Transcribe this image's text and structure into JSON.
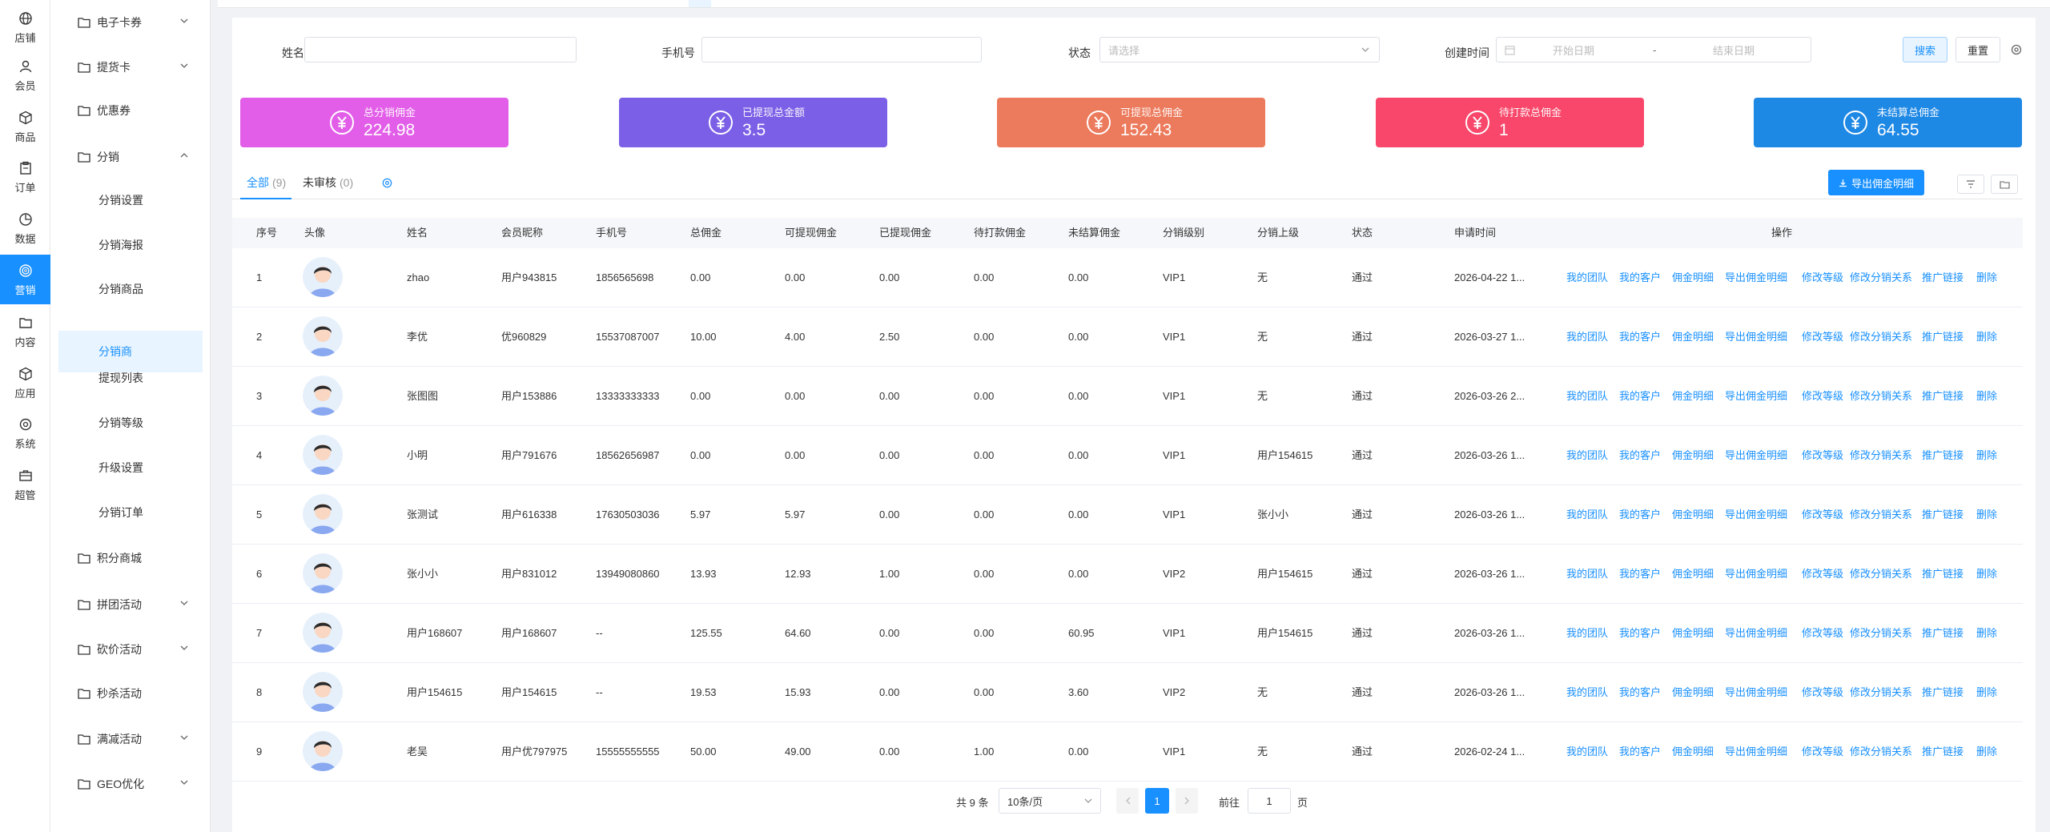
{
  "rail": [
    {
      "icon": "globe-icon",
      "label": "店铺"
    },
    {
      "icon": "user-icon",
      "label": "会员"
    },
    {
      "icon": "box-icon",
      "label": "商品"
    },
    {
      "icon": "clipboard-icon",
      "label": "订单"
    },
    {
      "icon": "chart-icon",
      "label": "数据"
    },
    {
      "icon": "target-icon",
      "label": "营销",
      "active": true
    },
    {
      "icon": "folder-icon",
      "label": "内容"
    },
    {
      "icon": "cube-icon",
      "label": "应用"
    },
    {
      "icon": "gear-icon",
      "label": "系统"
    },
    {
      "icon": "briefcase-icon",
      "label": "超管"
    }
  ],
  "sidebar": [
    {
      "label": "电子卡券",
      "type": "group",
      "chev": "down"
    },
    {
      "label": "提货卡",
      "type": "group",
      "chev": "down"
    },
    {
      "label": "优惠券",
      "type": "group"
    },
    {
      "label": "分销",
      "type": "group",
      "chev": "up"
    },
    {
      "label": "分销设置",
      "type": "sub"
    },
    {
      "label": "分销海报",
      "type": "sub"
    },
    {
      "label": "分销商品",
      "type": "sub"
    },
    {
      "label": "分销商",
      "type": "sub",
      "active": true
    },
    {
      "label": "提现列表",
      "type": "sub"
    },
    {
      "label": "分销等级",
      "type": "sub"
    },
    {
      "label": "升级设置",
      "type": "sub"
    },
    {
      "label": "分销订单",
      "type": "sub"
    },
    {
      "label": "积分商城",
      "type": "group"
    },
    {
      "label": "拼团活动",
      "type": "group",
      "chev": "down"
    },
    {
      "label": "砍价活动",
      "type": "group",
      "chev": "down"
    },
    {
      "label": "秒杀活动",
      "type": "group"
    },
    {
      "label": "满减活动",
      "type": "group",
      "chev": "down"
    },
    {
      "label": "GEO优化",
      "type": "group",
      "chev": "down"
    }
  ],
  "filters": {
    "name_label": "姓名",
    "phone_label": "手机号",
    "status_label": "状态",
    "status_placeholder": "请选择",
    "created_label": "创建时间",
    "start_placeholder": "开始日期",
    "range_sep": "-",
    "end_placeholder": "结束日期",
    "search_btn": "搜索",
    "reset_btn": "重置"
  },
  "stats": [
    {
      "label": "总分销佣金",
      "value": "224.98",
      "color": "#e25ee8"
    },
    {
      "label": "已提现总金额",
      "value": "3.5",
      "color": "#7b5fe6"
    },
    {
      "label": "可提现总佣金",
      "value": "152.43",
      "color": "#ec7a5c"
    },
    {
      "label": "待打款总佣金",
      "value": "1",
      "color": "#f8476a"
    },
    {
      "label": "未结算总佣金",
      "value": "64.55",
      "color": "#1e88e5"
    }
  ],
  "tabs": {
    "all_label": "全部",
    "all_count": "(9)",
    "pending_label": "未审核",
    "pending_count": "(0)"
  },
  "export_btn": "导出佣金明细",
  "table": {
    "headers": [
      "序号",
      "头像",
      "姓名",
      "会员昵称",
      "手机号",
      "总佣金",
      "可提现佣金",
      "已提现佣金",
      "待打款佣金",
      "未结算佣金",
      "分销级别",
      "分销上级",
      "状态",
      "申请时间",
      "操作"
    ],
    "actions": [
      "我的团队",
      "我的客户",
      "佣金明细",
      "导出佣金明细",
      "修改等级",
      "修改分销关系",
      "推广链接",
      "删除"
    ],
    "rows": [
      [
        "1",
        "zhao",
        "用户943815",
        "1856565698",
        "0.00",
        "0.00",
        "0.00",
        "0.00",
        "0.00",
        "VIP1",
        "无",
        "通过",
        "2026-04-22 1..."
      ],
      [
        "2",
        "李优",
        "优960829",
        "15537087007",
        "10.00",
        "4.00",
        "2.50",
        "0.00",
        "0.00",
        "VIP1",
        "无",
        "通过",
        "2026-03-27 1..."
      ],
      [
        "3",
        "张图图",
        "用户153886",
        "13333333333",
        "0.00",
        "0.00",
        "0.00",
        "0.00",
        "0.00",
        "VIP1",
        "无",
        "通过",
        "2026-03-26 2..."
      ],
      [
        "4",
        "小明",
        "用户791676",
        "18562656987",
        "0.00",
        "0.00",
        "0.00",
        "0.00",
        "0.00",
        "VIP1",
        "用户154615",
        "通过",
        "2026-03-26 1..."
      ],
      [
        "5",
        "张测试",
        "用户616338",
        "17630503036",
        "5.97",
        "5.97",
        "0.00",
        "0.00",
        "0.00",
        "VIP1",
        "张小小",
        "通过",
        "2026-03-26 1..."
      ],
      [
        "6",
        "张小小",
        "用户831012",
        "13949080860",
        "13.93",
        "12.93",
        "1.00",
        "0.00",
        "0.00",
        "VIP2",
        "用户154615",
        "通过",
        "2026-03-26 1..."
      ],
      [
        "7",
        "用户168607",
        "用户168607",
        "--",
        "125.55",
        "64.60",
        "0.00",
        "0.00",
        "60.95",
        "VIP1",
        "用户154615",
        "通过",
        "2026-03-26 1..."
      ],
      [
        "8",
        "用户154615",
        "用户154615",
        "--",
        "19.53",
        "15.93",
        "0.00",
        "0.00",
        "3.60",
        "VIP2",
        "无",
        "通过",
        "2026-03-26 1..."
      ],
      [
        "9",
        "老吴",
        "用户优797975",
        "15555555555",
        "50.00",
        "49.00",
        "0.00",
        "1.00",
        "0.00",
        "VIP1",
        "无",
        "通过",
        "2026-02-24 1..."
      ]
    ]
  },
  "pagination": {
    "total": "共 9 条",
    "page_size": "10条/页",
    "current": "1",
    "goto_label": "前往",
    "goto_value": "1",
    "page_suffix": "页"
  }
}
